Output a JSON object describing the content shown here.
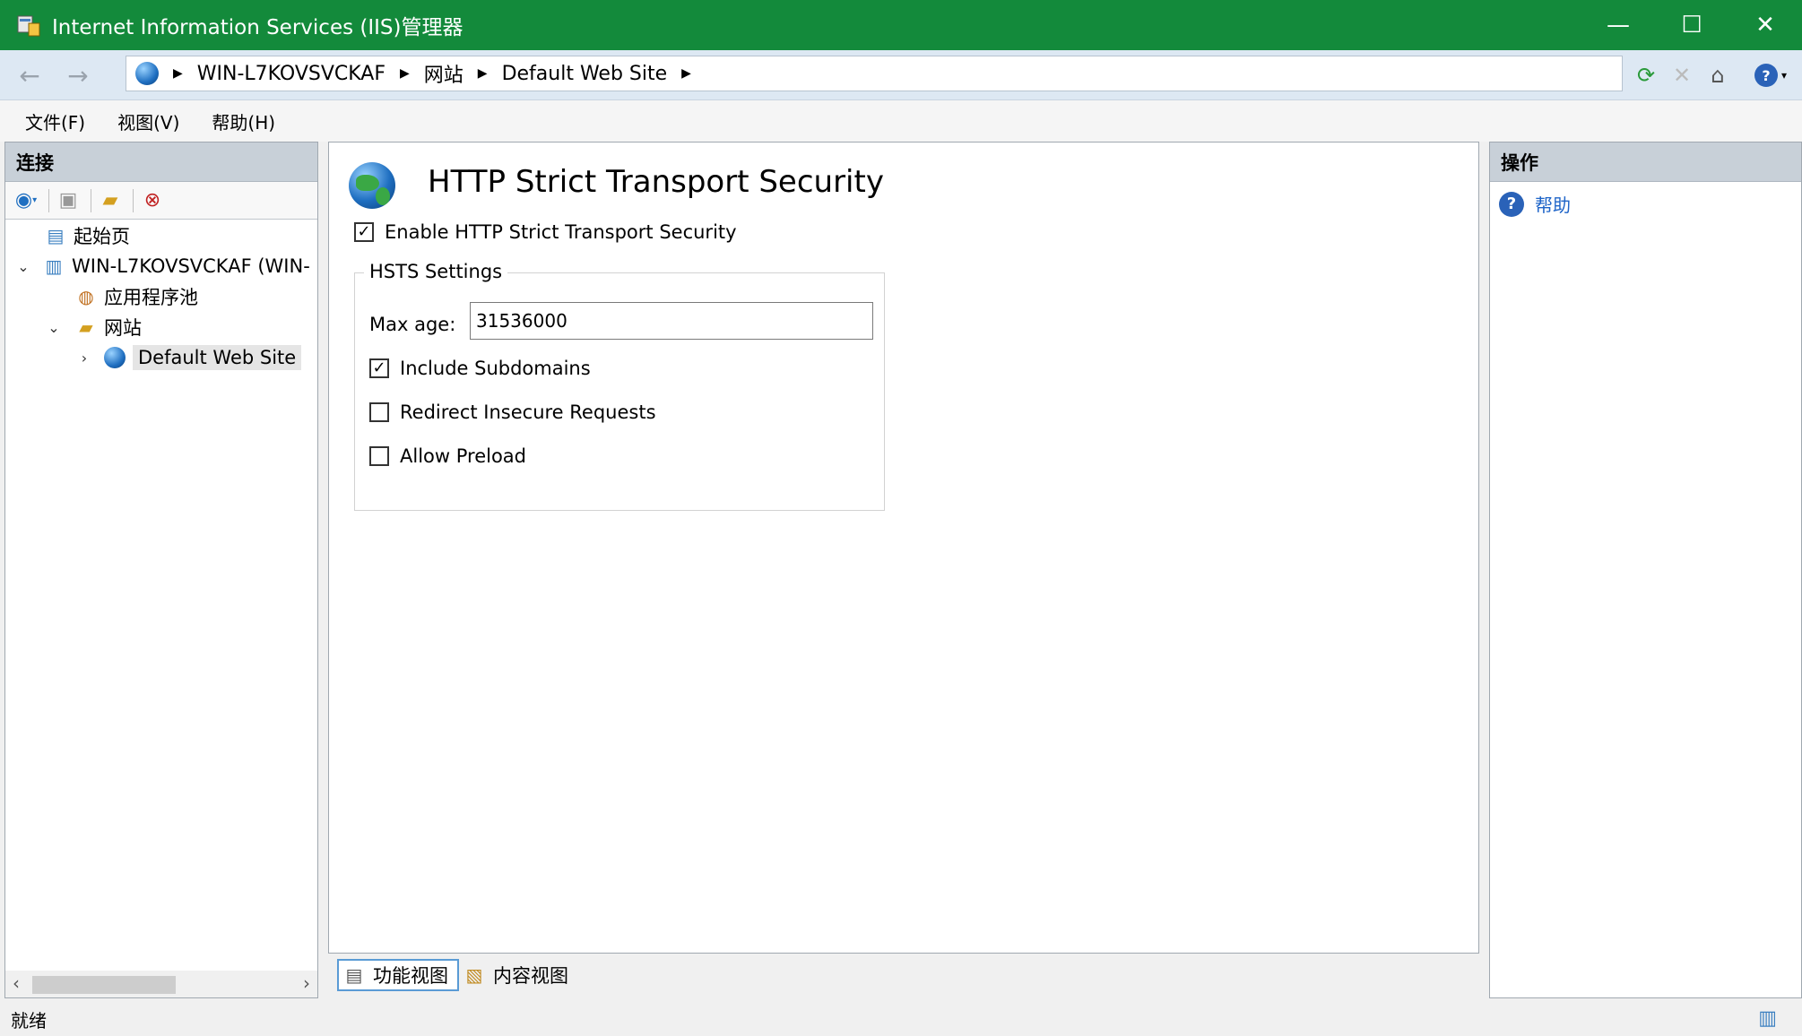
{
  "window": {
    "title": "Internet Information Services (IIS)管理器",
    "controls": {
      "minimize": "—",
      "maximize": "☐",
      "close": "✕"
    }
  },
  "address": {
    "back_icon": "back-arrow-icon",
    "forward_icon": "forward-arrow-icon",
    "crumbs": [
      "WIN-L7KOVSVCKAF",
      "网站",
      "Default Web Site"
    ],
    "toolbar_icons": [
      "refresh-icon",
      "stop-icon",
      "home-icon",
      "help-icon"
    ]
  },
  "menu": {
    "file": "文件(F)",
    "view": "视图(V)",
    "help": "帮助(H)"
  },
  "connections": {
    "header": "连接",
    "tree": [
      {
        "label": "起始页",
        "icon": "start-page-icon"
      },
      {
        "label": "WIN-L7KOVSVCKAF (WIN-",
        "icon": "server-icon"
      },
      {
        "label": "应用程序池",
        "icon": "app-pool-icon"
      },
      {
        "label": "网站",
        "icon": "sites-folder-icon"
      },
      {
        "label": "Default Web Site",
        "icon": "globe-icon"
      }
    ]
  },
  "main": {
    "title": "HTTP Strict Transport Security",
    "enable_label": "Enable HTTP Strict Transport Security",
    "enable_checked": true,
    "group_label": "HSTS Settings",
    "max_age_label": "Max age:",
    "max_age_value": "31536000",
    "include_subdomains_label": "Include Subdomains",
    "include_subdomains_checked": true,
    "redirect_label": "Redirect Insecure Requests",
    "redirect_checked": false,
    "preload_label": "Allow Preload",
    "preload_checked": false
  },
  "view_tabs": {
    "features": "功能视图",
    "content": "内容视图"
  },
  "actions": {
    "header": "操作",
    "help": "帮助"
  },
  "status": {
    "text": "就绪"
  }
}
